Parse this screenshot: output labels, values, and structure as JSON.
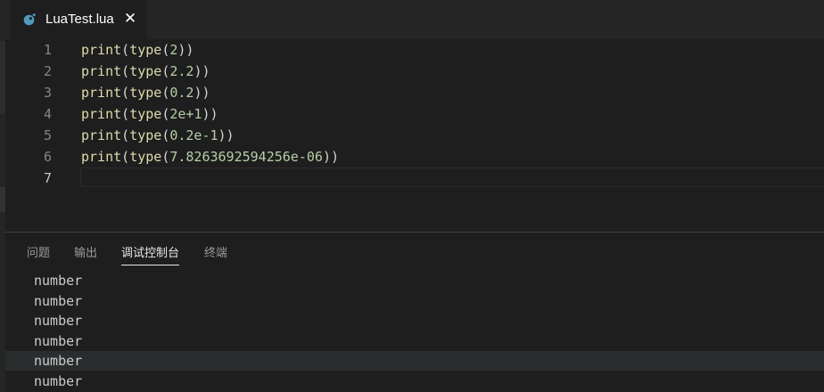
{
  "tab": {
    "filename": "LuaTest.lua",
    "close_glyph": "✕",
    "icon": "lua-file-icon"
  },
  "editor": {
    "lines": [
      {
        "number": "1",
        "fn": "print",
        "inner": "type",
        "arg": "2"
      },
      {
        "number": "2",
        "fn": "print",
        "inner": "type",
        "arg": "2.2"
      },
      {
        "number": "3",
        "fn": "print",
        "inner": "type",
        "arg": "0.2"
      },
      {
        "number": "4",
        "fn": "print",
        "inner": "type",
        "arg": "2e+1"
      },
      {
        "number": "5",
        "fn": "print",
        "inner": "type",
        "arg": "0.2e-1"
      },
      {
        "number": "6",
        "fn": "print",
        "inner": "type",
        "arg": "7.8263692594256e-06"
      },
      {
        "number": "7"
      }
    ]
  },
  "panel": {
    "tabs": [
      {
        "label": "问题"
      },
      {
        "label": "输出"
      },
      {
        "label": "调试控制台"
      },
      {
        "label": "终端"
      }
    ],
    "output": [
      "number",
      "number",
      "number",
      "number",
      "number",
      "number"
    ]
  },
  "colors": {
    "background": "#1e1e1e",
    "tabbar": "#252526",
    "function": "#dcdcaa",
    "number": "#b5cea8",
    "punctuation": "#d4d4d4",
    "lua_icon": "#519aba"
  }
}
